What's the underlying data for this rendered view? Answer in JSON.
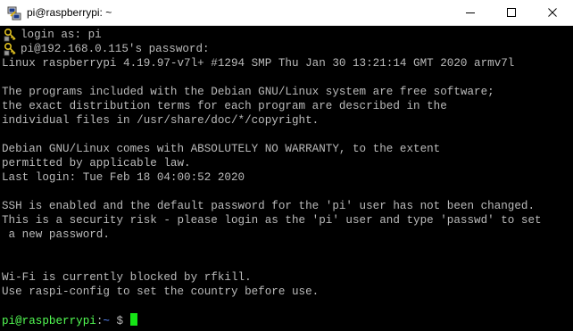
{
  "window": {
    "title": "pi@raspberrypi: ~",
    "controls": {
      "minimize_icon": "minimize-icon",
      "maximize_icon": "maximize-icon",
      "close_icon": "close-icon"
    }
  },
  "terminal": {
    "lines": [
      "login as: pi",
      "pi@192.168.0.115's password:",
      "Linux raspberrypi 4.19.97-v7l+ #1294 SMP Thu Jan 30 13:21:14 GMT 2020 armv7l",
      "",
      "The programs included with the Debian GNU/Linux system are free software;",
      "the exact distribution terms for each program are described in the",
      "individual files in /usr/share/doc/*/copyright.",
      "",
      "Debian GNU/Linux comes with ABSOLUTELY NO WARRANTY, to the extent",
      "permitted by applicable law.",
      "Last login: Tue Feb 18 04:00:52 2020",
      "",
      "SSH is enabled and the default password for the 'pi' user has not been changed.",
      "This is a security risk - please login as the 'pi' user and type 'passwd' to set",
      " a new password.",
      "",
      "",
      "Wi-Fi is currently blocked by rfkill.",
      "Use raspi-config to set the country before use.",
      ""
    ],
    "prompt": {
      "user_host": "pi@raspberrypi",
      "separator": ":",
      "path": "~",
      "symbol": " $ "
    }
  },
  "colors": {
    "background": "#000000",
    "text": "#bbbbbb",
    "prompt_user": "#54ff54",
    "prompt_path": "#5b8bff",
    "cursor": "#16e416"
  }
}
